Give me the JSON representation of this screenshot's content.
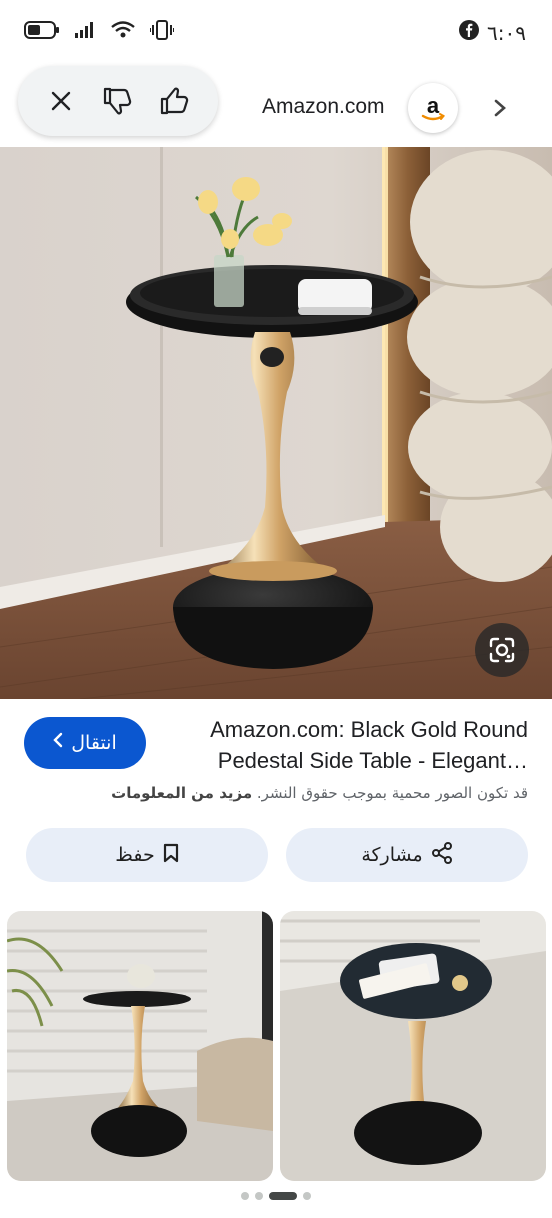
{
  "status_bar": {
    "time": "٦:٠٩",
    "battery_icon": "battery-icon",
    "signal_icon": "signal-icon",
    "wifi_icon": "wifi-icon",
    "vibrate_icon": "vibrate-icon",
    "facebook_icon": "facebook-icon"
  },
  "top_bar": {
    "site_name": "Amazon.com",
    "logo_letter": "a",
    "icons": [
      "close-icon",
      "thumbs-down-icon",
      "thumbs-up-icon",
      "chevron-right-icon"
    ]
  },
  "result": {
    "title": "Amazon.com: Black Gold Round Pedestal Side Table - Elegant…",
    "visit_label": "انتقال",
    "copyright_text": "قد تكون الصور محمية بموجب حقوق النشر.",
    "more_info_label": "مزيد من المعلومات",
    "share_label": "مشاركة",
    "save_label": "حفظ"
  },
  "carousel": {
    "page_count": 4,
    "active_index": 2
  },
  "colors": {
    "primary_button": "#0b57d0",
    "secondary_button": "#e8eef8",
    "pill_bg": "#f1f3f4"
  }
}
